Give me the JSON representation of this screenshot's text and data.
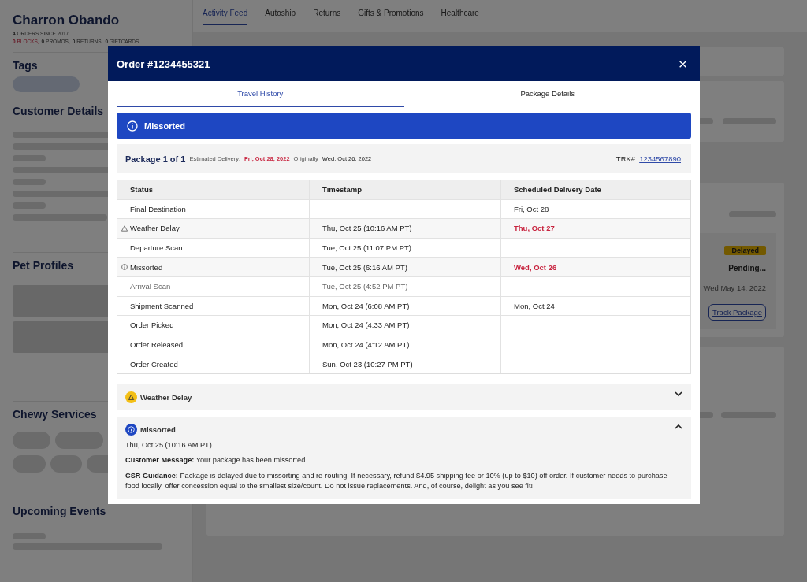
{
  "customer": {
    "name": "Charron Obando",
    "orders": "**4** ORDERS SINCE 2017",
    "stats": [
      {
        "text": "**0** BLOCKS,",
        "alert": true
      },
      {
        "text": "**0** PROMOS,",
        "alert": false
      },
      {
        "text": "**0** RETURNS,",
        "alert": false
      },
      {
        "text": "**0** GIFTCARDS",
        "alert": false
      }
    ]
  },
  "sidebar_sections": [
    {
      "title": "Tags",
      "kind": "tags"
    },
    {
      "title": "Customer Details",
      "kind": "lines"
    },
    {
      "title": "Pet Profiles",
      "kind": "blocks"
    },
    {
      "title": "Chewy Services",
      "kind": "chips"
    },
    {
      "title": "Upcoming Events",
      "kind": "events"
    }
  ],
  "nav_tabs": [
    {
      "label": "Activity Feed",
      "selected": true
    },
    {
      "label": "Autoship",
      "selected": false
    },
    {
      "label": "Returns",
      "selected": false
    },
    {
      "label": "Gifts & Promotions",
      "selected": false
    },
    {
      "label": "Healthcare",
      "selected": false
    }
  ],
  "shipment_card": {
    "badge": "Delayed",
    "status": "Pending...",
    "date": "Wed May 14, 2022",
    "button": "Track Package"
  },
  "modal": {
    "title": "Order #1234455321",
    "tabs": [
      {
        "label": "Travel History",
        "selected": true
      },
      {
        "label": "Package Details",
        "selected": false
      }
    ],
    "banner": {
      "kind": "info",
      "label": "Missorted"
    },
    "package": {
      "label": "Package 1 of 1",
      "estimated_label": "Estimated Delivery:",
      "estimated_date": "Fri, Oct 28, 2022",
      "original_label": "Originally",
      "original_date": "Wed, Oct 26, 2022",
      "tracking_label": "TRK#",
      "tracking_number": "1234567890"
    },
    "table": {
      "columns": [
        "Status",
        "Timestamp",
        "Scheduled Delivery Date"
      ],
      "rows": [
        {
          "kind": "plain",
          "status": "Final Destination",
          "scheduled": "Fri, Oct 28",
          "late": false,
          "muted": false
        },
        {
          "kind": "warning",
          "status": "Weather Delay",
          "timestamp": "Thu, Oct 25 (10:16 AM PT)",
          "scheduled": "Thu, Oct 27",
          "late": true,
          "muted": false
        },
        {
          "kind": "plain",
          "status": "Departure Scan",
          "timestamp": "Tue, Oct 25 (11:07 PM PT)",
          "muted": false
        },
        {
          "kind": "info",
          "status": "Missorted",
          "timestamp": "Tue, Oct 25 (6:16 AM PT)",
          "scheduled": "Wed, Oct 26",
          "late": true,
          "muted": false
        },
        {
          "kind": "plain",
          "status": "Arrival Scan",
          "timestamp": "Tue, Oct 25 (4:52 PM PT)",
          "muted": true
        },
        {
          "kind": "plain",
          "status": "Shipment Scanned",
          "timestamp": "Mon, Oct 24 (6:08 AM PT)",
          "scheduled": "Mon, Oct 24",
          "late": false,
          "muted": false
        },
        {
          "kind": "plain",
          "status": "Order Picked",
          "timestamp": "Mon, Oct 24 (4:33 AM PT)",
          "muted": false
        },
        {
          "kind": "plain",
          "status": "Order Released",
          "timestamp": "Mon, Oct 24 (4:12 AM PT)",
          "muted": false
        },
        {
          "kind": "plain",
          "status": "Order Created",
          "timestamp": "Sun, Oct 23 (10:27 PM PT)",
          "muted": false
        }
      ]
    },
    "alerts": [
      {
        "kind": "warning",
        "title": "Weather Delay",
        "expanded": false
      },
      {
        "kind": "info",
        "title": "Missorted",
        "expanded": true,
        "time": "Thu, Oct 25 (10:16 AM PT)",
        "lines": [
          "**Customer Message:** Your package has been missorted",
          "**CSR Guidance:** Package is delayed due to missorting and re-routing. If necessary, refund $4.95 shipping fee or 10% (up to $10) off order. If customer needs to purchase food locally, offer concession equal to the smallest size/count. Do not issue replacements. And, of course, delight as you see fit!"
        ]
      }
    ]
  }
}
